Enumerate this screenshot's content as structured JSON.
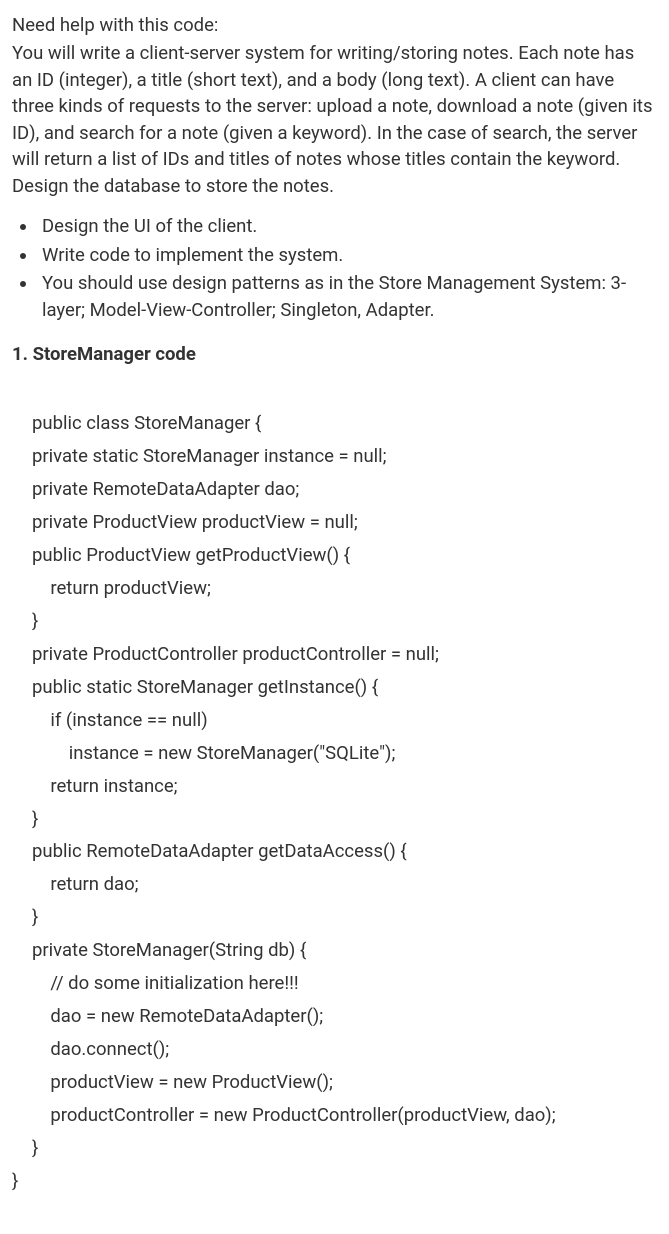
{
  "intro": "Need help with this code:",
  "description": "You will write a client-server system for writing/storing notes. Each note has an ID (integer), a title (short text), and a body (long text). A client can have three kinds of requests to the server: upload a note, download a note (given its ID), and search for a note (given a keyword). In the case of search, the server will return a list of IDs and titles of notes whose titles contain the keyword. Design the database to store the notes.",
  "bullets": [
    "Design the UI of the client.",
    "Write code to implement the system.",
    "You should use design patterns as in the Store Management System: 3-layer; Model-View-Controller; Singleton, Adapter."
  ],
  "sectionHeading": "1. StoreManager code",
  "code": "public class StoreManager {\nprivate static StoreManager instance = null;\nprivate RemoteDataAdapter dao;\nprivate ProductView productView = null;\npublic ProductView getProductView() {\n    return productView;\n}\nprivate ProductController productController = null;\npublic static StoreManager getInstance() {\n    if (instance == null)\n        instance = new StoreManager(\"SQLite\");\n    return instance;\n}\npublic RemoteDataAdapter getDataAccess() {\n    return dao;\n}\nprivate StoreManager(String db) {\n    // do some initialization here!!!\n    dao = new RemoteDataAdapter();\n    dao.connect();\n    productView = new ProductView();\n    productController = new ProductController(productView, dao);\n}",
  "codeTrailing": "}"
}
